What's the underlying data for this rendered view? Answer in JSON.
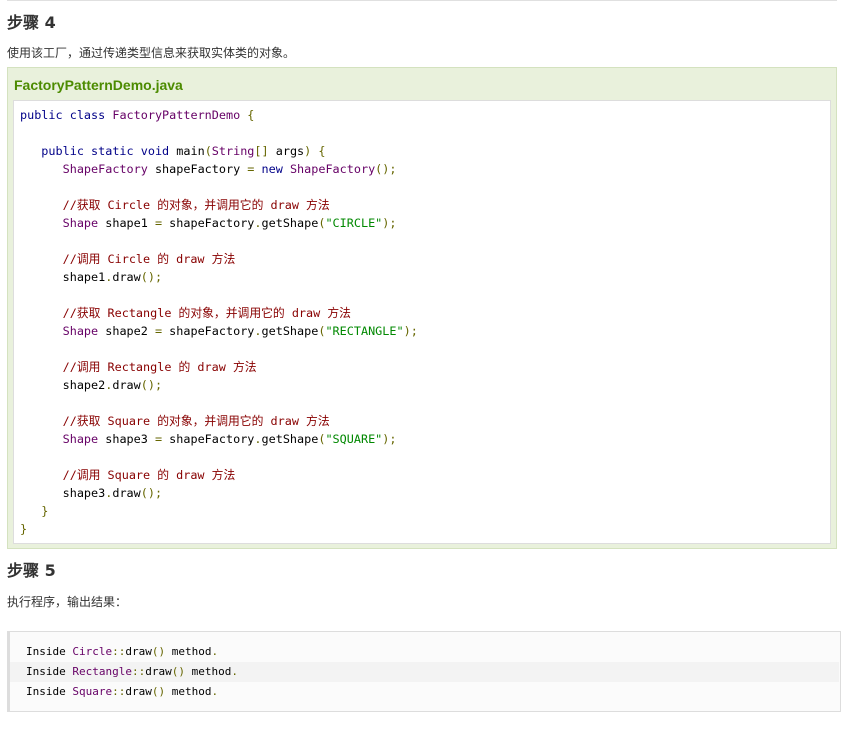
{
  "step4": {
    "heading": "步骤 4",
    "description": "使用该工厂，通过传递类型信息来获取实体类的对象。"
  },
  "example": {
    "filename": "FactoryPatternDemo.java",
    "code_lines": [
      [
        {
          "t": "public class ",
          "c": "kw"
        },
        {
          "t": "FactoryPatternDemo ",
          "c": "typ"
        },
        {
          "t": "{",
          "c": "pun"
        }
      ],
      [],
      [
        {
          "t": "   public static void ",
          "c": "kw"
        },
        {
          "t": "main",
          "c": "pln"
        },
        {
          "t": "(",
          "c": "pun"
        },
        {
          "t": "String",
          "c": "typ"
        },
        {
          "t": "[] ",
          "c": "pun"
        },
        {
          "t": "args",
          "c": "pln"
        },
        {
          "t": ") {",
          "c": "pun"
        }
      ],
      [
        {
          "t": "      ShapeFactory ",
          "c": "typ"
        },
        {
          "t": "shapeFactory ",
          "c": "pln"
        },
        {
          "t": "= ",
          "c": "pun"
        },
        {
          "t": "new ",
          "c": "kw"
        },
        {
          "t": "ShapeFactory",
          "c": "typ"
        },
        {
          "t": "();",
          "c": "pun"
        }
      ],
      [],
      [
        {
          "t": "      //获取 Circle 的对象，并调用它的 draw 方法",
          "c": "com"
        }
      ],
      [
        {
          "t": "      Shape ",
          "c": "typ"
        },
        {
          "t": "shape1 ",
          "c": "pln"
        },
        {
          "t": "= ",
          "c": "pun"
        },
        {
          "t": "shapeFactory",
          "c": "pln"
        },
        {
          "t": ".",
          "c": "pun"
        },
        {
          "t": "getShape",
          "c": "pln"
        },
        {
          "t": "(",
          "c": "pun"
        },
        {
          "t": "\"CIRCLE\"",
          "c": "str"
        },
        {
          "t": ");",
          "c": "pun"
        }
      ],
      [],
      [
        {
          "t": "      //调用 Circle 的 draw 方法",
          "c": "com"
        }
      ],
      [
        {
          "t": "      shape1",
          "c": "pln"
        },
        {
          "t": ".",
          "c": "pun"
        },
        {
          "t": "draw",
          "c": "pln"
        },
        {
          "t": "();",
          "c": "pun"
        }
      ],
      [],
      [
        {
          "t": "      //获取 Rectangle 的对象，并调用它的 draw 方法",
          "c": "com"
        }
      ],
      [
        {
          "t": "      Shape ",
          "c": "typ"
        },
        {
          "t": "shape2 ",
          "c": "pln"
        },
        {
          "t": "= ",
          "c": "pun"
        },
        {
          "t": "shapeFactory",
          "c": "pln"
        },
        {
          "t": ".",
          "c": "pun"
        },
        {
          "t": "getShape",
          "c": "pln"
        },
        {
          "t": "(",
          "c": "pun"
        },
        {
          "t": "\"RECTANGLE\"",
          "c": "str"
        },
        {
          "t": ");",
          "c": "pun"
        }
      ],
      [],
      [
        {
          "t": "      //调用 Rectangle 的 draw 方法",
          "c": "com"
        }
      ],
      [
        {
          "t": "      shape2",
          "c": "pln"
        },
        {
          "t": ".",
          "c": "pun"
        },
        {
          "t": "draw",
          "c": "pln"
        },
        {
          "t": "();",
          "c": "pun"
        }
      ],
      [],
      [
        {
          "t": "      //获取 Square 的对象，并调用它的 draw 方法",
          "c": "com"
        }
      ],
      [
        {
          "t": "      Shape ",
          "c": "typ"
        },
        {
          "t": "shape3 ",
          "c": "pln"
        },
        {
          "t": "= ",
          "c": "pun"
        },
        {
          "t": "shapeFactory",
          "c": "pln"
        },
        {
          "t": ".",
          "c": "pun"
        },
        {
          "t": "getShape",
          "c": "pln"
        },
        {
          "t": "(",
          "c": "pun"
        },
        {
          "t": "\"SQUARE\"",
          "c": "str"
        },
        {
          "t": ");",
          "c": "pun"
        }
      ],
      [],
      [
        {
          "t": "      //调用 Square 的 draw 方法",
          "c": "com"
        }
      ],
      [
        {
          "t": "      shape3",
          "c": "pln"
        },
        {
          "t": ".",
          "c": "pun"
        },
        {
          "t": "draw",
          "c": "pln"
        },
        {
          "t": "();",
          "c": "pun"
        }
      ],
      [
        {
          "t": "   }",
          "c": "pun"
        }
      ],
      [
        {
          "t": "}",
          "c": "pun"
        }
      ]
    ]
  },
  "step5": {
    "heading": "步骤 5",
    "description": "执行程序，输出结果："
  },
  "output": {
    "lines": [
      [
        {
          "t": "Inside ",
          "c": "pln"
        },
        {
          "t": "Circle",
          "c": "typ"
        },
        {
          "t": "::",
          "c": "pun"
        },
        {
          "t": "draw",
          "c": "pln"
        },
        {
          "t": "() ",
          "c": "pun"
        },
        {
          "t": "method",
          "c": "pln"
        },
        {
          "t": ".",
          "c": "pun"
        }
      ],
      [
        {
          "t": "Inside ",
          "c": "pln"
        },
        {
          "t": "Rectangle",
          "c": "typ"
        },
        {
          "t": "::",
          "c": "pun"
        },
        {
          "t": "draw",
          "c": "pln"
        },
        {
          "t": "() ",
          "c": "pun"
        },
        {
          "t": "method",
          "c": "pln"
        },
        {
          "t": ".",
          "c": "pun"
        }
      ],
      [
        {
          "t": "Inside ",
          "c": "pln"
        },
        {
          "t": "Square",
          "c": "typ"
        },
        {
          "t": "::",
          "c": "pun"
        },
        {
          "t": "draw",
          "c": "pln"
        },
        {
          "t": "() ",
          "c": "pun"
        },
        {
          "t": "method",
          "c": "pln"
        },
        {
          "t": ".",
          "c": "pun"
        }
      ]
    ]
  },
  "colors": {
    "example_background": "#e9f1dc",
    "filename_color": "#4c8b00",
    "keyword": "#000088",
    "type": "#660066",
    "string": "#008800",
    "comment": "#880000"
  }
}
